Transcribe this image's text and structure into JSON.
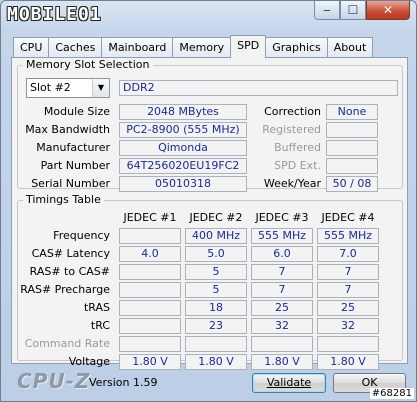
{
  "app": {
    "logo_text": "MOBILE01",
    "version": "Version 1.59",
    "brand": "CPU-Z"
  },
  "window_controls": {
    "minimize": "‒",
    "maximize": "☐",
    "close": "✕"
  },
  "tabs": [
    "CPU",
    "Caches",
    "Mainboard",
    "Memory",
    "SPD",
    "Graphics",
    "About"
  ],
  "active_tab": "SPD",
  "memory_slot": {
    "title": "Memory Slot Selection",
    "slot_selected": "Slot #2",
    "type": "DDR2",
    "left_rows": [
      {
        "label": "Module Size",
        "value": "2048 MBytes"
      },
      {
        "label": "Max Bandwidth",
        "value": "PC2-8900 (555 MHz)"
      },
      {
        "label": "Manufacturer",
        "value": "Qimonda"
      },
      {
        "label": "Part Number",
        "value": "64T256020EU19FC2"
      },
      {
        "label": "Serial Number",
        "value": "05010318"
      }
    ],
    "right_rows": [
      {
        "label": "Correction",
        "value": "None",
        "enabled": true
      },
      {
        "label": "Registered",
        "value": "",
        "enabled": false
      },
      {
        "label": "Buffered",
        "value": "",
        "enabled": false
      },
      {
        "label": "SPD Ext.",
        "value": "",
        "enabled": false
      },
      {
        "label": "Week/Year",
        "value": "50 / 08",
        "enabled": true
      }
    ]
  },
  "timings": {
    "title": "Timings Table",
    "columns": [
      "JEDEC #1",
      "JEDEC #2",
      "JEDEC #3",
      "JEDEC #4"
    ],
    "rows": [
      {
        "label": "Frequency",
        "enabled": true,
        "values": [
          "",
          "400 MHz",
          "555 MHz",
          "555 MHz"
        ]
      },
      {
        "label": "CAS# Latency",
        "enabled": true,
        "values": [
          "4.0",
          "5.0",
          "6.0",
          "7.0"
        ]
      },
      {
        "label": "RAS# to CAS#",
        "enabled": true,
        "values": [
          "",
          "5",
          "7",
          "7"
        ]
      },
      {
        "label": "RAS# Precharge",
        "enabled": true,
        "values": [
          "",
          "5",
          "7",
          "7"
        ]
      },
      {
        "label": "tRAS",
        "enabled": true,
        "values": [
          "",
          "18",
          "25",
          "25"
        ]
      },
      {
        "label": "tRC",
        "enabled": true,
        "values": [
          "",
          "23",
          "32",
          "32"
        ]
      },
      {
        "label": "Command Rate",
        "enabled": false,
        "values": [
          "",
          "",
          "",
          ""
        ]
      },
      {
        "label": "Voltage",
        "enabled": true,
        "values": [
          "1.80 V",
          "1.80 V",
          "1.80 V",
          "1.80 V"
        ]
      }
    ]
  },
  "buttons": {
    "validate": "Validate",
    "ok": "OK"
  },
  "watermark": "#68281"
}
